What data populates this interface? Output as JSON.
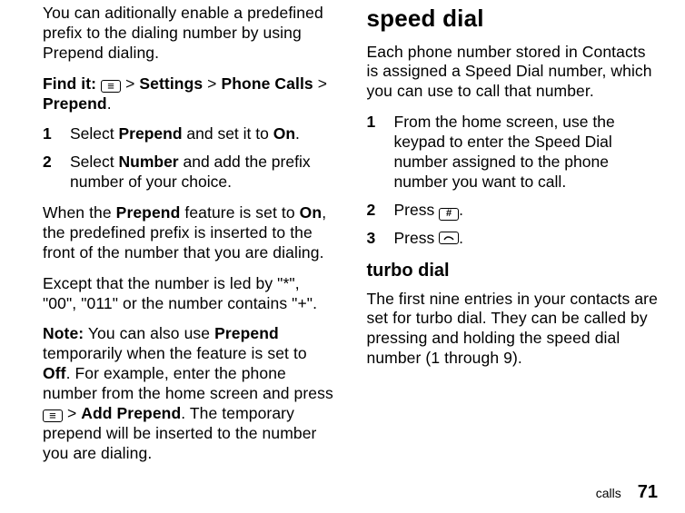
{
  "left": {
    "intro": "You can aditionally enable a predefined prefix to the dialing number by using Prepend dialing.",
    "findit_label": "Find it:",
    "findit_path_a": "Settings",
    "findit_path_b": "Phone Calls",
    "findit_path_c": "Prepend",
    "sep": ">",
    "period": ".",
    "steps": [
      {
        "num": "1",
        "pre": "Select ",
        "bold1": "Prepend",
        "mid": " and set it to ",
        "bold2": "On",
        "post": "."
      },
      {
        "num": "2",
        "pre": "Select ",
        "bold1": "Number",
        "mid": " and add the prefix number of your choice.",
        "bold2": "",
        "post": ""
      }
    ],
    "when_pre": "When the ",
    "when_b1": "Prepend",
    "when_mid": " feature is set to ",
    "when_b2": "On",
    "when_post": ", the predefined prefix is inserted to the front of the number that you are dialing.",
    "except": "Except that the number is led by \"*\", \"00\", \"011\" or the number contains \"+\".",
    "note_label": "Note:",
    "note_a": " You can also use ",
    "note_b1": "Prepend",
    "note_b": " temporarily when the feature is set to ",
    "note_b2": "Off",
    "note_c": ". For example, enter the phone number from the home screen and press ",
    "note_sep": " > ",
    "note_b3": "Add Prepend",
    "note_d": ". The temporary prepend will be inserted to the number you are dialing."
  },
  "right": {
    "h1": "speed dial",
    "intro": "Each phone number stored in Contacts is assigned a Speed Dial number, which you can use to call that number.",
    "steps": [
      {
        "num": "1",
        "text": "From the home screen, use the keypad to enter the Speed Dial number assigned to the phone number you want to call."
      },
      {
        "num": "2",
        "text_pre": "Press ",
        "icon": "hash",
        "text_post": "."
      },
      {
        "num": "3",
        "text_pre": "Press ",
        "icon": "call",
        "text_post": "."
      }
    ],
    "h2": "turbo dial",
    "turbo": "The first nine entries in your contacts are set for turbo dial. They can be called by pressing and holding the speed dial number (1 through 9)."
  },
  "footer": {
    "section": "calls",
    "page": "71"
  }
}
